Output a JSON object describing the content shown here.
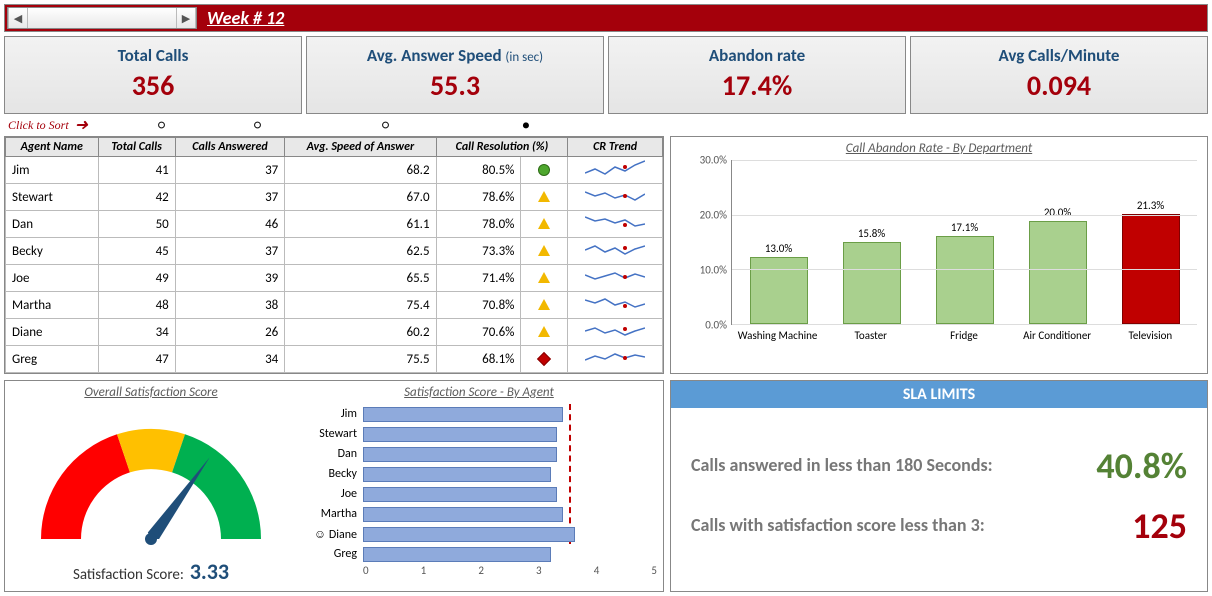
{
  "header": {
    "week_label": "Week # 12"
  },
  "kpis": [
    {
      "title": "Total Calls",
      "sub": "",
      "value": "356"
    },
    {
      "title": "Avg. Answer Speed",
      "sub": "(in sec)",
      "value": "55.3"
    },
    {
      "title": "Abandon rate",
      "sub": "",
      "value": "17.4%"
    },
    {
      "title": "Avg Calls/Minute",
      "sub": "",
      "value": "0.094"
    }
  ],
  "sort_hint": "Click to Sort",
  "agent_table": {
    "columns": [
      "Agent Name",
      "Total Calls",
      "Calls Answered",
      "Avg. Speed of Answer",
      "Call Resolution (%)",
      "CR Trend"
    ],
    "rows": [
      {
        "name": "Jim",
        "total": 41,
        "answered": 37,
        "speed": "68.2",
        "res": "80.5%",
        "ind": "green"
      },
      {
        "name": "Stewart",
        "total": 42,
        "answered": 37,
        "speed": "67.0",
        "res": "78.6%",
        "ind": "yellow"
      },
      {
        "name": "Dan",
        "total": 50,
        "answered": 46,
        "speed": "61.1",
        "res": "78.0%",
        "ind": "yellow"
      },
      {
        "name": "Becky",
        "total": 45,
        "answered": 37,
        "speed": "62.5",
        "res": "73.3%",
        "ind": "yellow"
      },
      {
        "name": "Joe",
        "total": 49,
        "answered": 39,
        "speed": "65.5",
        "res": "71.4%",
        "ind": "yellow"
      },
      {
        "name": "Martha",
        "total": 48,
        "answered": 38,
        "speed": "75.4",
        "res": "70.8%",
        "ind": "yellow"
      },
      {
        "name": "Diane",
        "total": 34,
        "answered": 26,
        "speed": "60.2",
        "res": "70.6%",
        "ind": "yellow"
      },
      {
        "name": "Greg",
        "total": 47,
        "answered": 34,
        "speed": "75.5",
        "res": "68.1%",
        "ind": "red"
      }
    ]
  },
  "gauge": {
    "title": "Overall Satisfaction Score",
    "label": "Satisfaction Score:",
    "value": "3.33"
  },
  "agent_bars": {
    "title": "Satisfaction Score - By Agent",
    "max": 5,
    "target": 3.5,
    "rows": [
      {
        "name": "Jim",
        "v": 3.4,
        "smile": false
      },
      {
        "name": "Stewart",
        "v": 3.3,
        "smile": false
      },
      {
        "name": "Dan",
        "v": 3.3,
        "smile": false
      },
      {
        "name": "Becky",
        "v": 3.2,
        "smile": false
      },
      {
        "name": "Joe",
        "v": 3.3,
        "smile": false
      },
      {
        "name": "Martha",
        "v": 3.4,
        "smile": false
      },
      {
        "name": "Diane",
        "v": 3.6,
        "smile": true
      },
      {
        "name": "Greg",
        "v": 3.2,
        "smile": false
      }
    ],
    "ticks": [
      "0",
      "1",
      "2",
      "3",
      "4",
      "5"
    ]
  },
  "sla": {
    "header": "SLA LIMITS",
    "r1_text": "Calls answered in less than 180 Seconds:",
    "r1_value": "40.8%",
    "r2_text": "Calls with satisfaction score less than 3:",
    "r2_value": "125"
  },
  "chart_data": {
    "type": "bar",
    "title": "Call Abandon Rate - By Department",
    "categories": [
      "Washing Machine",
      "Toaster",
      "Fridge",
      "Air Conditioner",
      "Television"
    ],
    "values": [
      13.0,
      15.8,
      17.1,
      20.0,
      21.3
    ],
    "highlight_index": 4,
    "ylabel": "",
    "ylim": [
      0,
      30
    ],
    "yticks": [
      0,
      10,
      20,
      30
    ],
    "value_format": "percent"
  }
}
